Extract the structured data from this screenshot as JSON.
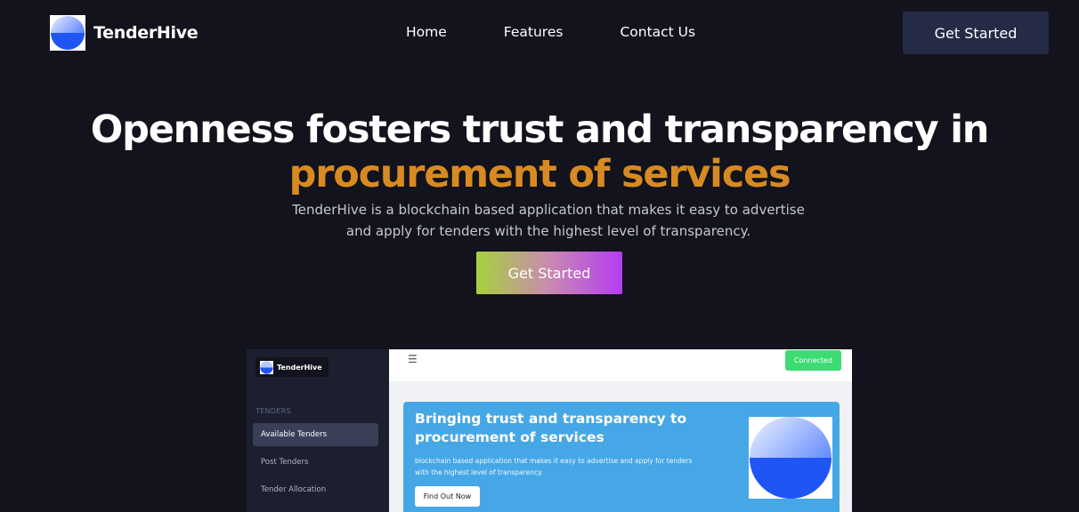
{
  "brand": {
    "name": "TenderHive"
  },
  "nav": {
    "links": [
      "Home",
      "Features",
      "Contact Us"
    ],
    "cta": "Get Started"
  },
  "hero": {
    "title_line1": "Openness fosters trust and transparency in",
    "title_line2": "procurement of services",
    "subtitle": "TenderHive is a blockchain based application that makes it easy to advertise and apply for tenders with the highest level of transparency.",
    "cta": "Get Started"
  },
  "preview": {
    "brand": "TenderHive",
    "section_label": "TENDERS",
    "sidebar_items": [
      "Available Tenders",
      "Post Tenders",
      "Tender Allocation"
    ],
    "menu_icon": "☰",
    "status": "Connected",
    "banner": {
      "title": "Bringing trust and transparency to procurement of services",
      "text": "blockchain based application that makes it easy to advertise and apply for tenders with the highest level of transparency.",
      "button": "Find Out Now"
    }
  },
  "colors": {
    "background": "#12131c",
    "accent_orange": "#d88a22",
    "nav_button": "#252a45",
    "banner_blue": "#46a7e6",
    "connected_green": "#3ddb74"
  }
}
